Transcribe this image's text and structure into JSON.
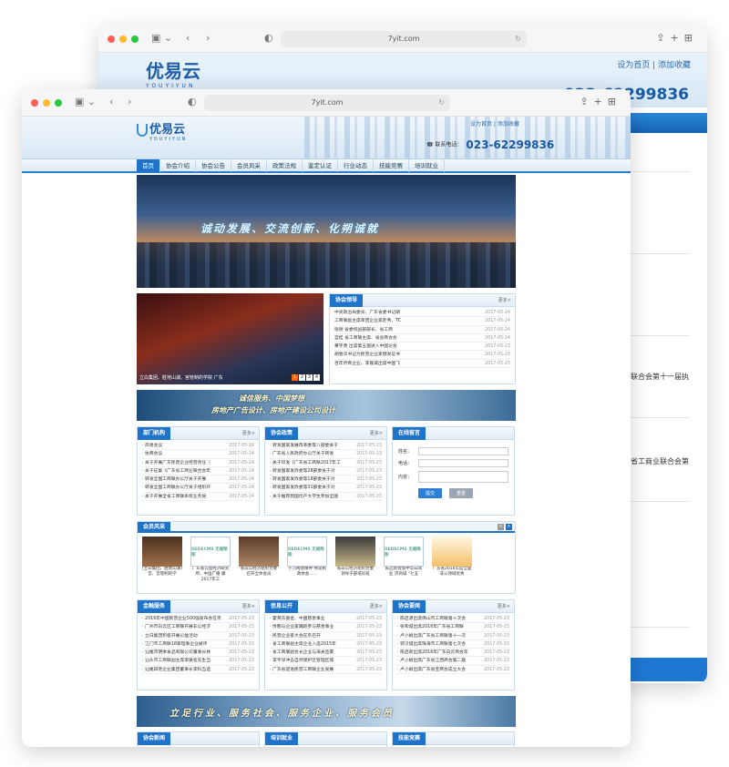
{
  "browser": {
    "back_url": "7yit.com",
    "front_url": "7yit.com"
  },
  "back": {
    "logo": "优易云",
    "logo_sub": "YOUYIYUN",
    "links": "设为首页 | 添加收藏",
    "phone": "023-62299836",
    "frag1": "联合会第十一届执",
    "frag2": "省工商业联合会第"
  },
  "site": {
    "logo": "优易云",
    "logo_sub": "YOUYIYUN",
    "links": "设为首页 | 添加收藏",
    "phone_label": "联系电话：",
    "phone": "023-62299836",
    "nav": [
      "首页",
      "协会介绍",
      "协会公告",
      "会员风采",
      "政策法规",
      "鉴定认证",
      "行业动态",
      "技能竞赛",
      "培训就业"
    ],
    "banner_slogan": "诚动发展、交流创新、化朔诚就",
    "slide_caption": "立白集团、胜地山湖、宫管制的学院 广东",
    "pager": [
      "1",
      "2",
      "3",
      "4"
    ],
    "leaders": {
      "title": "协会领导",
      "more": "更多>",
      "items": [
        {
          "t": "中央政治局委员、广东省委书记胡",
          "d": "2017-05-24"
        },
        {
          "t": "工商联副主席率团企业家赴粤，TC",
          "d": "2017-05-24"
        },
        {
          "t": "张德 省委统战部部长、省工商",
          "d": "2017-05-24"
        },
        {
          "t": "宫桂 省工商联主席、省总商会会",
          "d": "2017-05-24"
        },
        {
          "t": "黄宇勇 出席第五届进入中国论会",
          "d": "2017-05-23"
        },
        {
          "t": "胡春华书记为民营企业家颁发证书",
          "d": "2017-05-23"
        },
        {
          "t": "百年侨商企业、李嘉诚出席中国飞",
          "d": "2017-05-23"
        }
      ]
    },
    "ad1_line1": "诚信服务、中国梦想",
    "ad1_line2": "房地产广告设计、房地产建设公司设计",
    "dept": {
      "title": "部门机构",
      "more": "更多>",
      "items": [
        {
          "t": "· 简易会议",
          "d": "2017-05-24"
        },
        {
          "t": "· 协商会议",
          "d": "2017-05-24"
        },
        {
          "t": "· 关于开展广东民营企业经营责任（",
          "d": "2017-05-24"
        },
        {
          "t": "· 关于征集《广东省工商业联合会年",
          "d": "2017-05-24"
        },
        {
          "t": "· 转发全国工商联办公厅关于开展",
          "d": "2017-05-24"
        },
        {
          "t": "· 转发全国工商联办公厅关于组织开",
          "d": "2017-05-24"
        },
        {
          "t": "· 关于开展全省工商联系统业务培",
          "d": "2017-05-24"
        }
      ]
    },
    "policy": {
      "title": "协会政策",
      "more": "更多>",
      "items": [
        {
          "t": "· 转发国家发展改革委等八部委关于",
          "d": "2017-05-23"
        },
        {
          "t": "· 广东省人民政府办公厅关于转发",
          "d": "2017-05-23"
        },
        {
          "t": "· 关于印发《广东省工商联2017年工",
          "d": "2017-05-23"
        },
        {
          "t": "· 转发国家发改委等28部委关于对",
          "d": "2017-05-23"
        },
        {
          "t": "· 转发国家发改委等18部委关于对",
          "d": "2017-05-23"
        },
        {
          "t": "· 转发国家发改委等31部委关于对",
          "d": "2017-05-23"
        },
        {
          "t": "· 关于推荐我国优产大学生参加全国",
          "d": "2017-05-23"
        }
      ]
    },
    "message": {
      "title": "在线留言",
      "name": "姓名：",
      "phone": "电话：",
      "content": "内容：",
      "submit": "提交",
      "reset": "重置"
    },
    "members": {
      "title": "会员风采",
      "prev": "<",
      "next": ">",
      "items": [
        {
          "cap": "(立白集团、胜地山湖) 宫、宫管制的学",
          "img": "a",
          "ph": ""
        },
        {
          "cap": "广东省公益经济研究所、中国广播 康2017年工",
          "img": "b",
          "ph": "DEDECMS 无缩略图"
        },
        {
          "cap": "省非公经济组织党委 召开全体会员",
          "img": "c",
          "ph": ""
        },
        {
          "cap": "学习两会精神 畅谈执 政体会……",
          "img": "b",
          "ph": "DEDECMS 无缩略图"
        },
        {
          "cap": "省非公经济组织党委 领导于部培训班",
          "img": "d",
          "ph": ""
        },
        {
          "cap": "陈启新会加中华白商业 济商城 “七五",
          "img": "b",
          "ph": "DEDECMS 无缩略图"
        },
        {
          "cap": "广东省2016年度全面 非公领域优秀",
          "img": "e",
          "ph": ""
        }
      ]
    },
    "finance": {
      "title": "金融服务",
      "more": "更多>",
      "items": [
        {
          "t": "· 2016年中国民营企业500强发布会在京",
          "d": "2017-05-23"
        },
        {
          "t": "· 广州市白云区工商联开展非公经济",
          "d": "2017-05-23"
        },
        {
          "t": "· 立白集团积极开展公益活动",
          "d": "2017-05-23"
        },
        {
          "t": "· 江门市工商联18家理事企业被评",
          "d": "2017-05-23"
        },
        {
          "t": "· 汕尾市明季食品有限公司董事长林",
          "d": "2017-05-23"
        },
        {
          "t": "· 汕头市工商联副主席李振名先生当",
          "d": "2017-05-23"
        },
        {
          "t": "· 汕尾四钜企业集团董事长李科当选",
          "d": "2017-05-23"
        }
      ]
    },
    "info": {
      "title": "信息公开",
      "more": "更多>",
      "items": [
        {
          "t": "· 霍英东基金、中国慈善事业",
          "d": "2017-05-23"
        },
        {
          "t": "· 侨胞与企业家踊跃参与慈善事业",
          "d": "2017-05-23"
        },
        {
          "t": "· 民营企业家大会在京召开",
          "d": "2017-05-23"
        },
        {
          "t": "· 省工商联副主席企业入选2015年",
          "d": "2017-05-23"
        },
        {
          "t": "· 省工商联副会长企业与海关签署",
          "d": "2017-05-23"
        },
        {
          "t": "· 李宇深冲击自然保护区管理区域",
          "d": "2017-05-23"
        },
        {
          "t": "· 广东省促进民营工商联企业发展",
          "d": "2017-05-23"
        }
      ]
    },
    "dynamics": {
      "title": "协会要闻",
      "more": "更多>",
      "items": [
        {
          "t": "· 陈启源出席佛山市工商联第十次会",
          "d": "2017-05-23"
        },
        {
          "t": "· 张和城出席2016年广东省工商联",
          "d": "2017-05-23"
        },
        {
          "t": "· 卢小娟出席广东省工商联第十一次",
          "d": "2017-05-23"
        },
        {
          "t": "· 郭汉城出席珠海市工商联第七次会",
          "d": "2017-05-23"
        },
        {
          "t": "· 陈启新出席2016年广东白云商会年",
          "d": "2017-05-23"
        },
        {
          "t": "· 卢小娟出席广东省江西商会第二届",
          "d": "2017-05-23"
        },
        {
          "t": "· 卢小娟出席广东省宝商会成立大会",
          "d": "2017-05-23"
        }
      ]
    },
    "ad2": "立足行业、服务社会、服务企业、服务会员",
    "bottom_titles": [
      "协会新闻",
      "培训就业",
      "技能竞赛"
    ]
  }
}
